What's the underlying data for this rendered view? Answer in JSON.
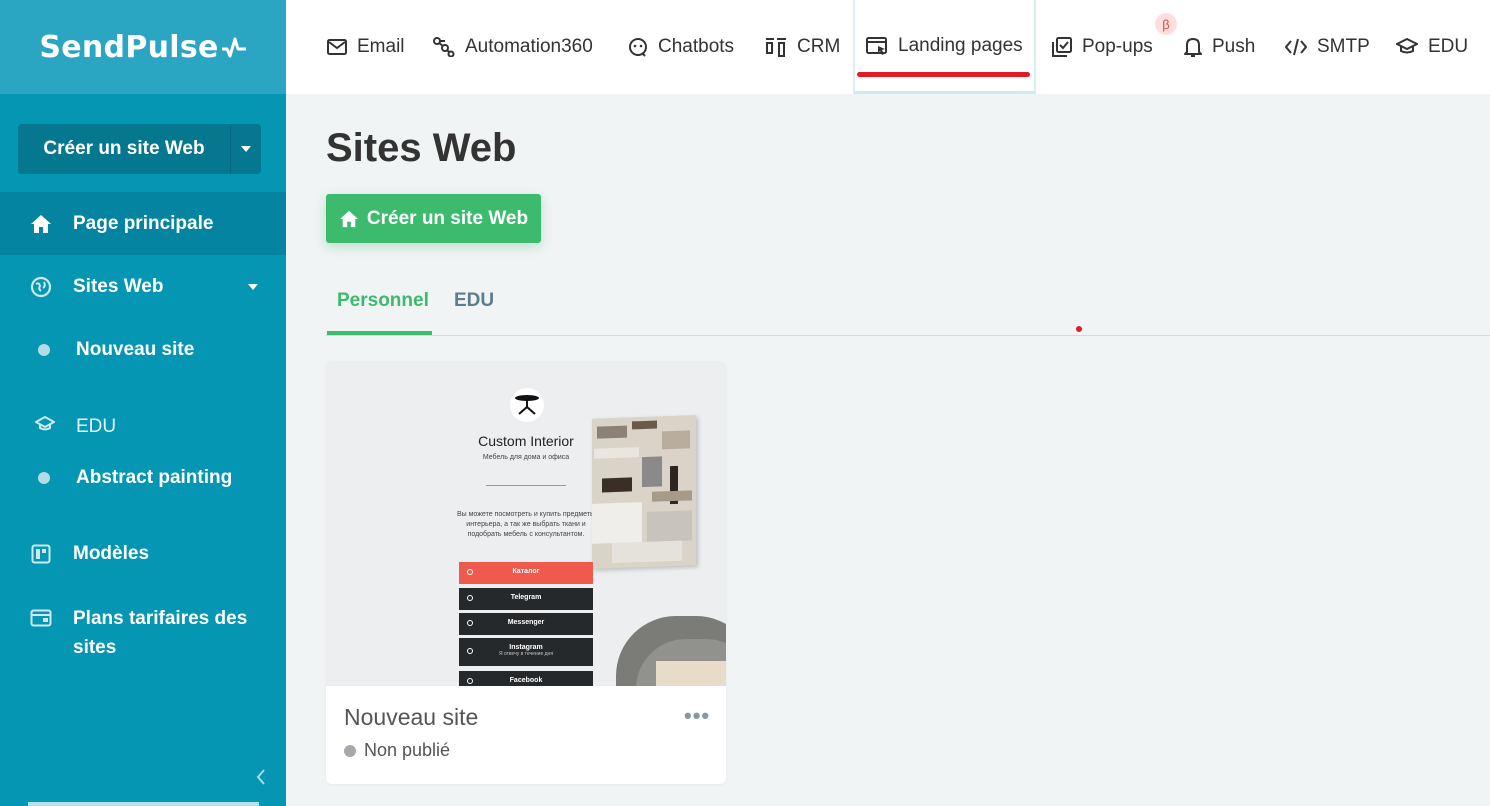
{
  "brand": {
    "name": "SendPulse"
  },
  "sidebar": {
    "create_button": "Créer un site Web",
    "items": [
      {
        "label": "Page principale",
        "icon": "home-icon"
      },
      {
        "label": "Sites Web",
        "icon": "globe-icon"
      },
      {
        "label": "Nouveau site"
      },
      {
        "label": "EDU",
        "icon": "graduation-cap-icon"
      },
      {
        "label": "Abstract painting"
      },
      {
        "label": "Modèles",
        "icon": "templates-icon"
      },
      {
        "label": "Plans tarifaires des sites",
        "icon": "wallet-icon"
      }
    ]
  },
  "topnav": {
    "tabs": [
      {
        "label": "Email",
        "icon": "envelope-icon"
      },
      {
        "label": "Automation360",
        "icon": "automation-icon"
      },
      {
        "label": "Chatbots",
        "icon": "chatbot-icon"
      },
      {
        "label": "CRM",
        "icon": "crm-icon"
      },
      {
        "label": "Landing pages",
        "icon": "landing-icon",
        "active": true
      },
      {
        "label": "Pop-ups",
        "icon": "popup-icon"
      },
      {
        "label": "Push",
        "icon": "bell-icon"
      },
      {
        "label": "SMTP",
        "icon": "code-icon"
      },
      {
        "label": "EDU",
        "icon": "graduation-cap-icon"
      }
    ],
    "beta_badge": "β"
  },
  "main": {
    "title": "Sites Web",
    "create_button": "Créer un site Web",
    "tabs": [
      {
        "label": "Personnel",
        "active": true
      },
      {
        "label": "EDU"
      }
    ]
  },
  "sites": [
    {
      "name": "Nouveau site",
      "status": "Non publié",
      "menu": "•••",
      "preview": {
        "title": "Custom Interior",
        "subtitle": "Мебель для дома и офиса",
        "description": "Вы можете посмотреть и купить предметы интерьера, а так же выбрать ткани и подобрать мебель с консультантом.",
        "buttons": [
          {
            "label": "Каталог",
            "sub": ""
          },
          {
            "label": "Telegram",
            "sub": ""
          },
          {
            "label": "Messenger",
            "sub": ""
          },
          {
            "label": "Instagram",
            "sub": "Я отвечу в течение дня"
          },
          {
            "label": "Facebook",
            "sub": ""
          }
        ]
      }
    }
  ],
  "colors": {
    "sidebar": "#0496b3",
    "accent_green": "#3cba6d",
    "active_underline": "#e31b23"
  }
}
